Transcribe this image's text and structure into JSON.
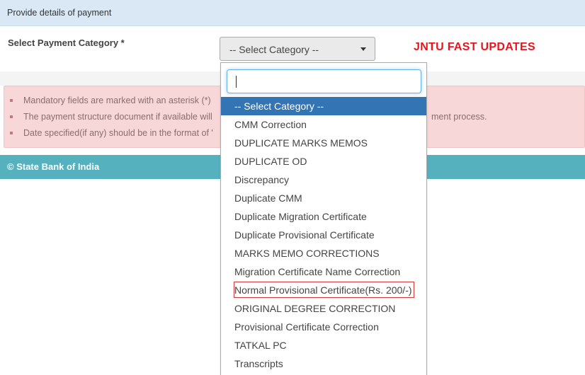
{
  "panel": {
    "heading": "Provide details of payment"
  },
  "form": {
    "label": "Select Payment Category *",
    "select_value": "-- Select Category --"
  },
  "watermark": "JNTU FAST UPDATES",
  "notes": {
    "items": [
      "Mandatory fields are marked with an asterisk (*)",
      "The payment structure document if available will",
      "Date specified(if any) should be in the format of '"
    ],
    "tail_text": "ment process."
  },
  "footer": {
    "text": "© State Bank of India"
  },
  "dropdown": {
    "search_value": "",
    "options": [
      "-- Select Category --",
      "CMM Correction",
      "DUPLICATE MARKS MEMOS",
      "DUPLICATE OD",
      "Discrepancy",
      "Duplicate CMM",
      "Duplicate Migration Certificate",
      "Duplicate Provisional Certificate",
      "MARKS MEMO CORRECTIONS",
      "Migration Certificate Name Correction",
      "Normal Provisional Certificate(Rs. 200/-)",
      "ORIGINAL DEGREE CORRECTION",
      "Provisional Certificate Correction",
      "TATKAL PC",
      "Transcripts"
    ],
    "selected_index": 0,
    "highlighted_index": 10
  }
}
